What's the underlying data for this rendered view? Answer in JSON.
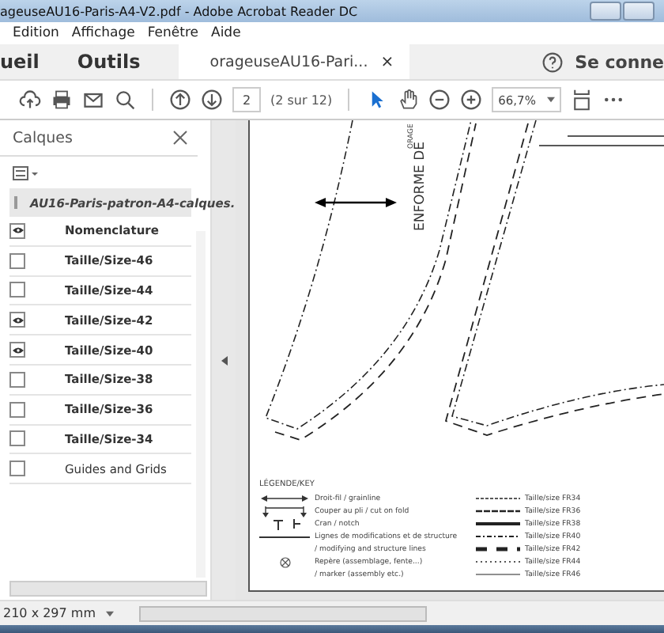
{
  "window": {
    "title": "ageuseAU16-Paris-A4-V2.pdf - Adobe Acrobat Reader DC"
  },
  "menu": [
    "Edition",
    "Affichage",
    "Fenêtre",
    "Aide"
  ],
  "tabs": [
    {
      "label": "ueil",
      "selected": false
    },
    {
      "label": "Outils",
      "selected": false
    },
    {
      "label": "orageuseAU16-Pari...",
      "selected": true,
      "close": "×"
    }
  ],
  "account": {
    "label": "Se conne"
  },
  "toolbar": {
    "page": "2",
    "page_count": "(2 sur 12)",
    "zoom": "66,7%"
  },
  "layers_panel": {
    "title": "Calques",
    "root": "AU16-Paris-patron-A4-calques.",
    "layers": [
      {
        "name": "Nomenclature",
        "visible": true,
        "kind": "layer"
      },
      {
        "name": "Taille/Size-46",
        "visible": false,
        "kind": "layer"
      },
      {
        "name": "Taille/Size-44",
        "visible": false,
        "kind": "layer"
      },
      {
        "name": "Taille/Size-42",
        "visible": true,
        "kind": "layer"
      },
      {
        "name": "Taille/Size-40",
        "visible": true,
        "kind": "layer"
      },
      {
        "name": "Taille/Size-38",
        "visible": false,
        "kind": "layer"
      },
      {
        "name": "Taille/Size-36",
        "visible": false,
        "kind": "layer"
      },
      {
        "name": "Taille/Size-34",
        "visible": false,
        "kind": "layer"
      },
      {
        "name": "Guides and Grids",
        "visible": false,
        "kind": "guide"
      }
    ]
  },
  "document": {
    "pattern_labels": [
      "ORAGE",
      "ENFORME DE"
    ],
    "legend": {
      "title": "LÉGENDE/KEY",
      "entries": [
        {
          "text": "Droit-fil / grainline",
          "kind": "grainline"
        },
        {
          "text": "Couper au pli / cut on fold",
          "kind": "fold"
        },
        {
          "text": "Cran / notch",
          "kind": "notch"
        },
        {
          "text": "Lignes de modifications et de structure",
          "kind": "line"
        },
        {
          "text": "/ modifying and structure lines",
          "kind": "none"
        },
        {
          "text": "Repère (assemblage, fente...)",
          "kind": "marker"
        },
        {
          "text": "/ marker (assembly etc.)",
          "kind": "none"
        }
      ],
      "sizes": [
        {
          "label": "Taille/size FR34",
          "kind": "dashed"
        },
        {
          "label": "Taille/size FR36",
          "kind": "long-dash"
        },
        {
          "label": "Taille/size FR38",
          "kind": "thick"
        },
        {
          "label": "Taille/size FR40",
          "kind": "dash-dot"
        },
        {
          "label": "Taille/size FR42",
          "kind": "bold-dash"
        },
        {
          "label": "Taille/size FR44",
          "kind": "dotted"
        },
        {
          "label": "Taille/size FR46",
          "kind": "solid"
        }
      ]
    }
  },
  "status_bar": {
    "page_size": "210 x 297 mm"
  }
}
